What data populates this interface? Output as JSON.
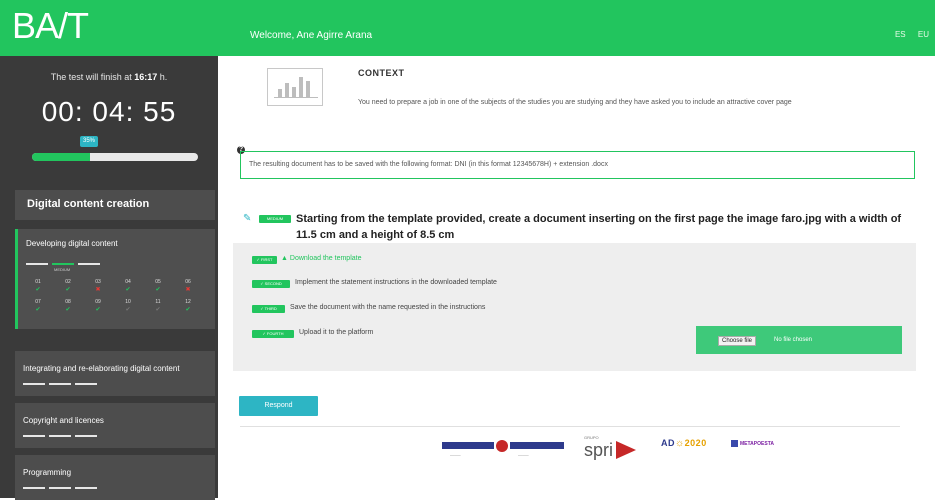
{
  "header": {
    "logo": "BA/T",
    "welcome": "Welcome, Ane Agirre Arana",
    "lang_es": "ES",
    "lang_eu": "EU"
  },
  "sidebar": {
    "timer_caption_prefix": "The test will finish at ",
    "timer_finish_time": "16:17",
    "timer_caption_suffix": " h.",
    "timer": "00: 04: 55",
    "progress_percent": 35,
    "progress_label": "35%",
    "section_title": "Digital content creation",
    "active_item": {
      "label": "Developing digital content",
      "level": "MEDIUM",
      "questions": [
        {
          "num": "01",
          "status": "ok"
        },
        {
          "num": "02",
          "status": "ok"
        },
        {
          "num": "03",
          "status": "bad"
        },
        {
          "num": "04",
          "status": "ok"
        },
        {
          "num": "05",
          "status": "ok"
        },
        {
          "num": "06",
          "status": "bad"
        },
        {
          "num": "07",
          "status": "ok"
        },
        {
          "num": "08",
          "status": "ok"
        },
        {
          "num": "09",
          "status": "ok"
        },
        {
          "num": "10",
          "status": "none"
        },
        {
          "num": "11",
          "status": "none"
        },
        {
          "num": "12",
          "status": "ok"
        }
      ]
    },
    "items": [
      {
        "label": "Integrating and re-elaborating digital content"
      },
      {
        "label": "Copyright and licences"
      },
      {
        "label": "Programming"
      }
    ]
  },
  "context": {
    "title": "CONTEXT",
    "body": "You need to prepare a job in one of the subjects of the studies you are studying and they have asked you to include an attractive cover page"
  },
  "notice": {
    "text": "The resulting document has to be saved with the following format: DNI (in this format 12345678H) + extension .docx"
  },
  "task": {
    "level_badge": "MEDIUM",
    "statement": "Starting from the template provided, create a document inserting on the first page the image faro.jpg with a width of 11.5 cm and a height of 8.5 cm"
  },
  "steps": [
    {
      "badge": "✓ FIRST",
      "text": "Download the template",
      "link": true
    },
    {
      "badge": "✓ SECOND",
      "text": "Implement the statement instructions in the downloaded template",
      "link": false
    },
    {
      "badge": "✓ THIRD",
      "text": "Save the document with the name requested in the instructions",
      "link": false
    },
    {
      "badge": "✓ FOURTH",
      "text": "Upload it to the platform",
      "link": false
    }
  ],
  "upload": {
    "choose_label": "Choose file",
    "no_file_label": "No file chosen"
  },
  "respond_label": "Respond",
  "footer": {
    "spri_small": "GRUPO",
    "spri": "spri",
    "ad_prefix": "AD",
    "ad_year": "2020",
    "metapoesta": "METAPOESTA"
  },
  "colors": {
    "brand_green": "#22c55e",
    "accent_teal": "#2db5c4",
    "sidebar_bg": "#3a3a3a",
    "error_red": "#e53935"
  }
}
